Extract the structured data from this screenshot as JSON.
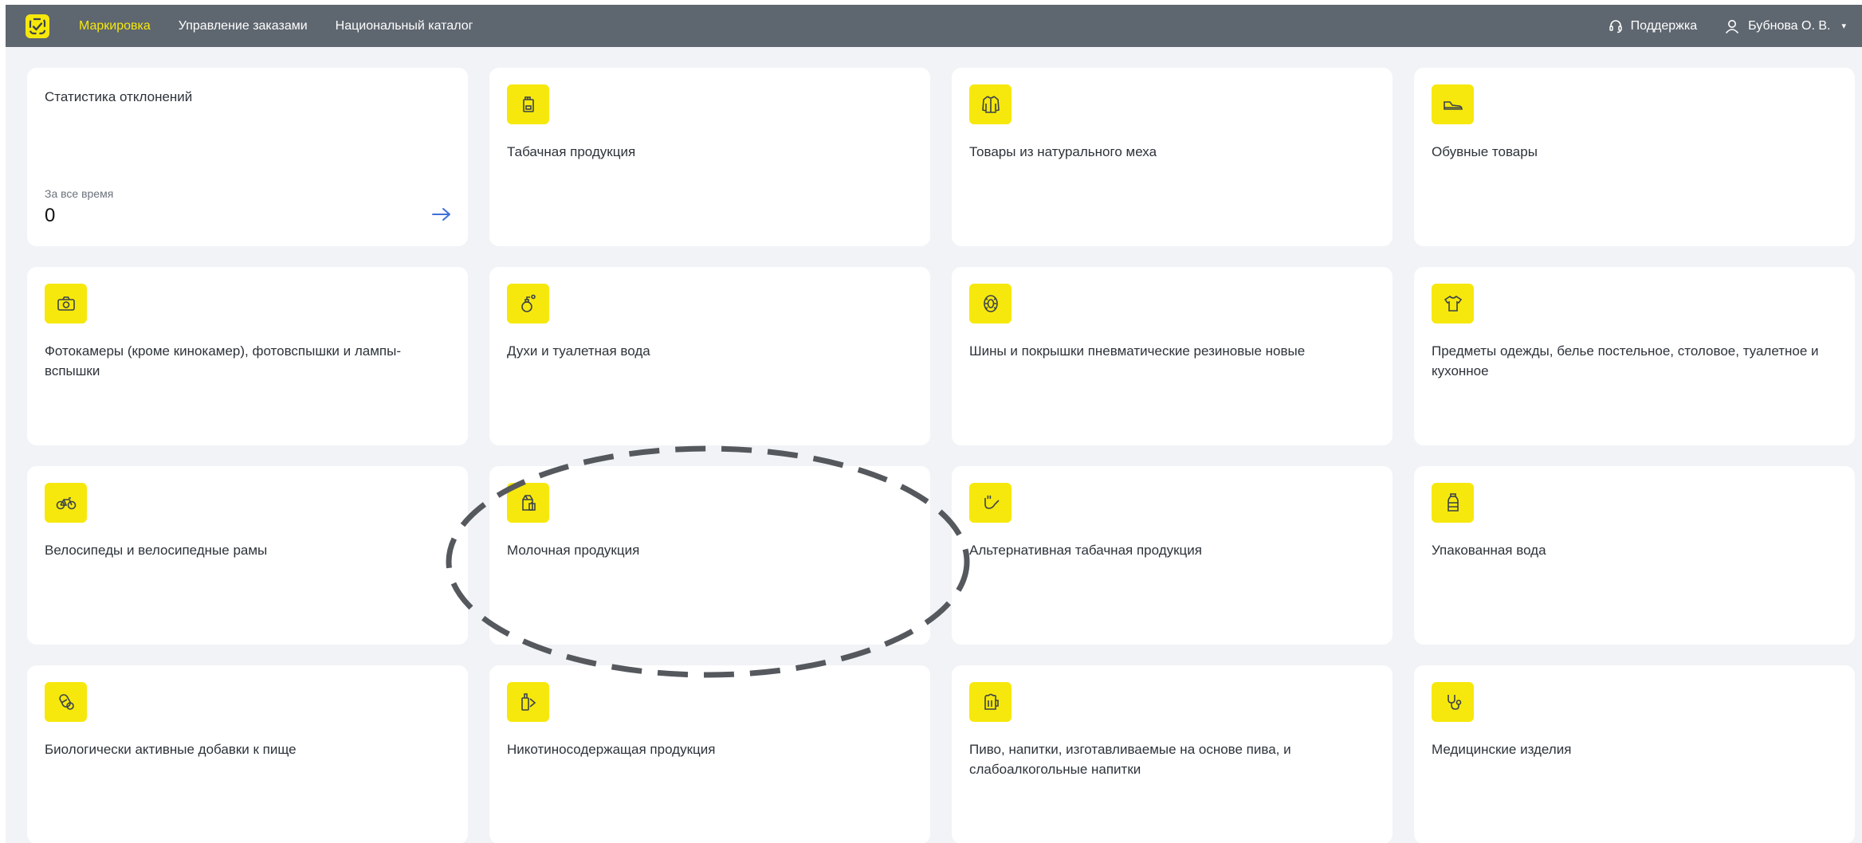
{
  "header": {
    "logo_icon": "chestny-znak-logo-icon",
    "nav": [
      {
        "label": "Маркировка",
        "active": true
      },
      {
        "label": "Управление заказами",
        "active": false
      },
      {
        "label": "Национальный каталог",
        "active": false
      }
    ],
    "support_label": "Поддержка",
    "support_icon": "headset-icon",
    "user_name": "Бубнова О. В.",
    "user_icon": "user-icon"
  },
  "stats_card": {
    "title": "Статистика отклонений",
    "period": "За все время",
    "value": "0",
    "arrow_icon": "arrow-right-icon"
  },
  "categories": [
    {
      "label": "Табачная продукция",
      "icon": "cigarette-pack-icon"
    },
    {
      "label": "Товары из натурального меха",
      "icon": "fur-coat-icon"
    },
    {
      "label": "Обувные товары",
      "icon": "shoe-icon"
    },
    {
      "label": "Фотокамеры (кроме кинокамер), фотовспышки и лампы-вспышки",
      "icon": "camera-icon"
    },
    {
      "label": "Духи и туалетная вода",
      "icon": "perfume-icon"
    },
    {
      "label": "Шины и покрышки пневматические резиновые новые",
      "icon": "tire-icon"
    },
    {
      "label": "Предметы одежды, белье постельное, столовое, туалетное и кухонное",
      "icon": "tshirt-icon"
    },
    {
      "label": "Велосипеды и велосипедные рамы",
      "icon": "bicycle-icon"
    },
    {
      "label": "Молочная продукция",
      "icon": "milk-icon"
    },
    {
      "label": "Альтернативная табачная продукция",
      "icon": "pipe-icon"
    },
    {
      "label": "Упакованная вода",
      "icon": "water-bottle-icon"
    },
    {
      "label": "Биологически активные добавки к пище",
      "icon": "supplements-icon"
    },
    {
      "label": "Никотиносодержащая продукция",
      "icon": "nicotine-icon"
    },
    {
      "label": "Пиво, напитки, изготавливаемые на основе пива, и слабоалкогольные напитки",
      "icon": "beer-icon"
    },
    {
      "label": "Медицинские изделия",
      "icon": "stethoscope-icon"
    }
  ],
  "colors": {
    "topbar": "#5e666f",
    "accent_yellow": "#f6e80c",
    "page_bg": "#f1f3f6",
    "card_bg": "#ffffff",
    "link_blue": "#3f6fd8",
    "annotation_stroke": "#55595e"
  }
}
